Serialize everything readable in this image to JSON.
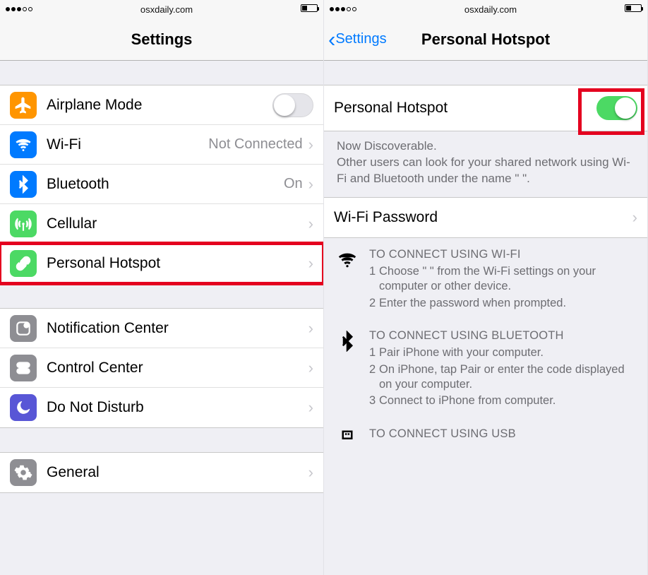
{
  "status_url": "osxdaily.com",
  "left": {
    "title": "Settings",
    "rows_a": [
      {
        "id": "airplane",
        "label": "Airplane Mode",
        "value": "",
        "toggle": "off",
        "icon": "airplane",
        "color": "bg-orange"
      },
      {
        "id": "wifi",
        "label": "Wi-Fi",
        "value": "Not Connected",
        "disclosure": true,
        "icon": "wifi",
        "color": "bg-blue"
      },
      {
        "id": "bluetooth",
        "label": "Bluetooth",
        "value": "On",
        "disclosure": true,
        "icon": "bluetooth",
        "color": "bg-blue"
      },
      {
        "id": "cellular",
        "label": "Cellular",
        "value": "",
        "disclosure": true,
        "icon": "antenna",
        "color": "bg-green"
      },
      {
        "id": "hotspot",
        "label": "Personal Hotspot",
        "value": "",
        "disclosure": true,
        "icon": "link",
        "color": "bg-green",
        "highlight": true
      }
    ],
    "rows_b": [
      {
        "id": "notif",
        "label": "Notification Center",
        "disclosure": true,
        "icon": "notification",
        "color": "bg-gray"
      },
      {
        "id": "control",
        "label": "Control Center",
        "disclosure": true,
        "icon": "switches",
        "color": "bg-gray"
      },
      {
        "id": "dnd",
        "label": "Do Not Disturb",
        "disclosure": true,
        "icon": "moon",
        "color": "bg-indigo"
      }
    ],
    "rows_c": [
      {
        "id": "general",
        "label": "General",
        "disclosure": true,
        "icon": "gear",
        "color": "bg-gray"
      }
    ]
  },
  "right": {
    "back_label": "Settings",
    "title": "Personal Hotspot",
    "toggle_row_label": "Personal Hotspot",
    "toggle_state": "on",
    "discoverable_heading": "Now Discoverable.",
    "discoverable_body": "Other users can look for your shared network using Wi-Fi and Bluetooth under the name \"                          \".",
    "wifi_pw_label": "Wi-Fi Password",
    "instructions": [
      {
        "icon": "wifi",
        "title": "TO CONNECT USING WI-FI",
        "steps": [
          "Choose \"                          \" from the Wi-Fi settings on your computer or other device.",
          "Enter the password when prompted."
        ]
      },
      {
        "icon": "bluetooth",
        "title": "TO CONNECT USING BLUETOOTH",
        "steps": [
          "Pair iPhone with your computer.",
          "On iPhone, tap Pair or enter the code displayed on your computer.",
          "Connect to iPhone from computer."
        ]
      },
      {
        "icon": "usb",
        "title": "TO CONNECT USING USB",
        "steps": []
      }
    ]
  }
}
